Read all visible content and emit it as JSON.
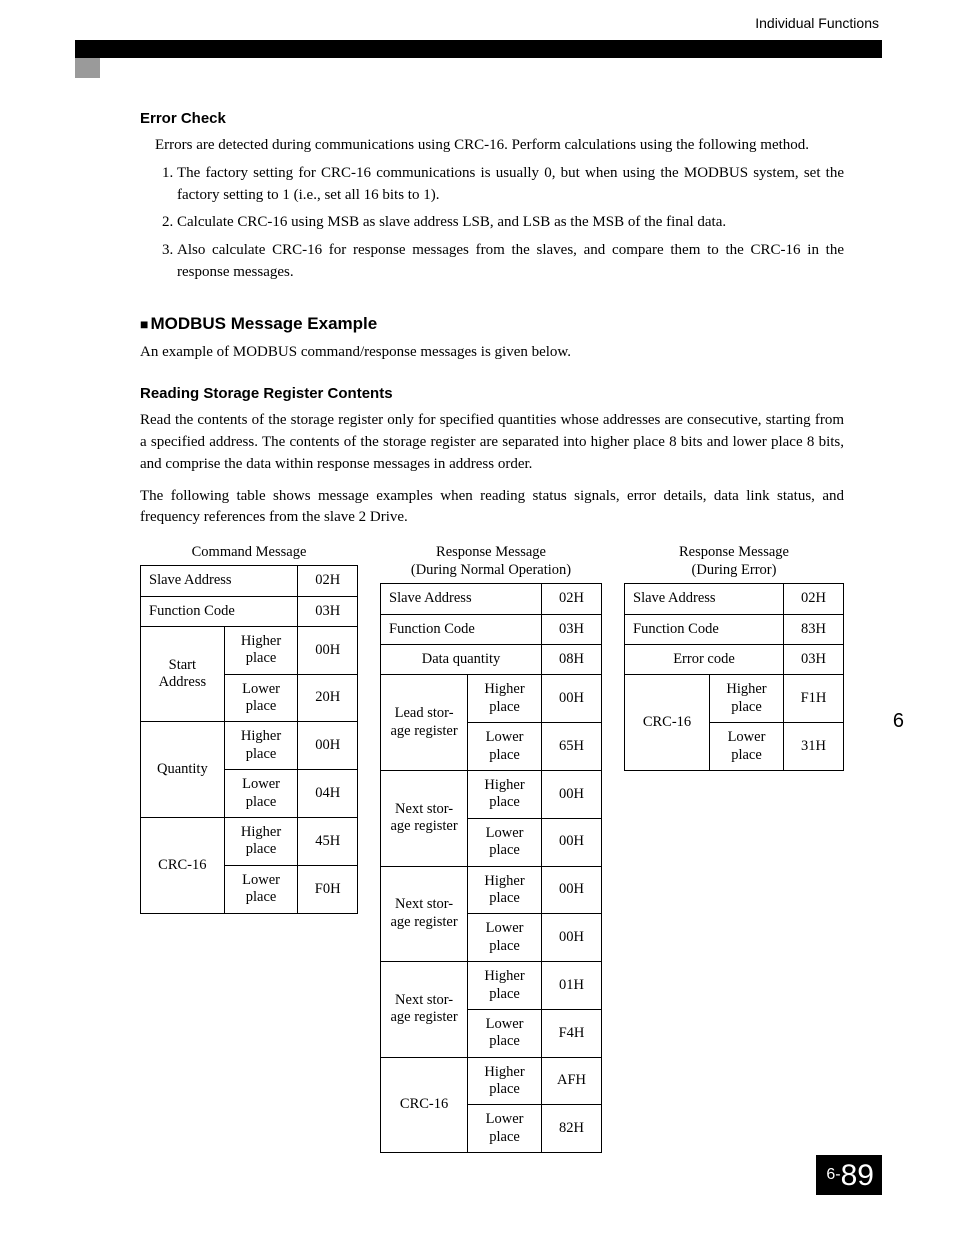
{
  "header": {
    "section": "Individual Functions"
  },
  "side_marker": "6",
  "page_number": {
    "prefix": "6-",
    "num": "89"
  },
  "error_check": {
    "heading": "Error Check",
    "intro": "Errors are detected during communications using CRC-16. Perform calculations using the following method.",
    "steps": [
      "The factory setting for CRC-16 communications is usually 0, but when using the MODBUS system, set the factory setting to 1 (i.e., set all 16 bits to 1).",
      "Calculate CRC-16 using MSB as slave address LSB, and LSB as the MSB of the final data.",
      "Also calculate CRC-16 for response messages from the slaves, and compare them to the CRC-16 in the response messages."
    ]
  },
  "modbus_example": {
    "heading": "MODBUS Message Example",
    "intro": "An example of MODBUS command/response messages is given below.",
    "sub_heading": "Reading Storage Register Contents",
    "para1": "Read the contents of the storage register only for specified quantities whose addresses are consecutive, starting from a specified address. The contents of the storage register are separated into higher place 8 bits and lower place 8 bits, and comprise the data within response messages in address order.",
    "para2": "The following table shows message examples when reading status signals, error details, data link status, and frequency references from the slave 2 Drive."
  },
  "labels": {
    "slave_address": "Slave Address",
    "function_code": "Function Code",
    "start_address": "Start\nAddress",
    "quantity": "Quantity",
    "crc16": "CRC-16",
    "higher": "Higher\nplace",
    "lower": "Lower\nplace",
    "data_quantity": "Data quantity",
    "lead_storage": "Lead stor-\nage register",
    "next_storage": "Next stor-\nage register",
    "error_code": "Error code"
  },
  "captions": {
    "cmd": "Command Message",
    "resp_normal": "Response Message\n(During Normal Operation)",
    "resp_error": "Response Message\n(During Error)"
  },
  "cmd": {
    "slave_address": "02H",
    "function_code": "03H",
    "start_hi": "00H",
    "start_lo": "20H",
    "qty_hi": "00H",
    "qty_lo": "04H",
    "crc_hi": "45H",
    "crc_lo": "F0H"
  },
  "resp_n": {
    "slave_address": "02H",
    "function_code": "03H",
    "data_quantity": "08H",
    "lead_hi": "00H",
    "lead_lo": "65H",
    "n1_hi": "00H",
    "n1_lo": "00H",
    "n2_hi": "00H",
    "n2_lo": "00H",
    "n3_hi": "01H",
    "n3_lo": "F4H",
    "crc_hi": "AFH",
    "crc_lo": "82H"
  },
  "resp_e": {
    "slave_address": "02H",
    "function_code": "83H",
    "error_code": "03H",
    "crc_hi": "F1H",
    "crc_lo": "31H"
  }
}
